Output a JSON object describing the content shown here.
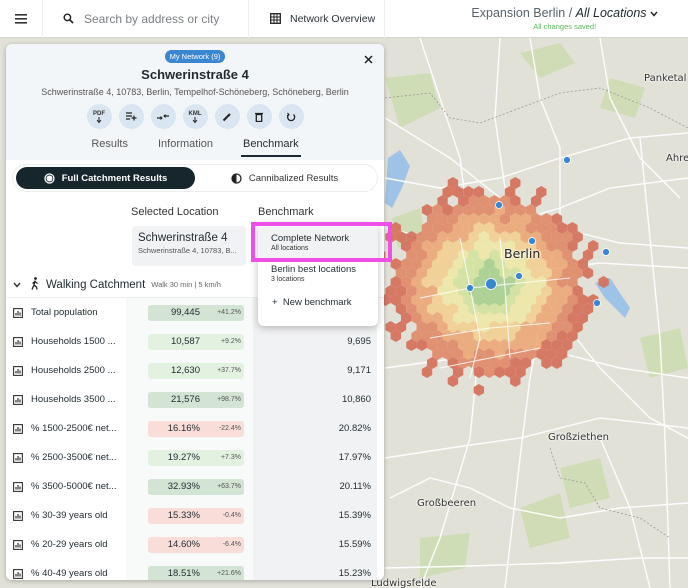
{
  "topbar": {
    "search_placeholder": "Search by address or city",
    "network_overview_label": "Network Overview",
    "project_name": "Expansion Berlin",
    "project_separator": " / ",
    "project_scope": "All Locations",
    "save_status": "All changes saved!"
  },
  "panel": {
    "badge": "My Network (9)",
    "title": "Schwerinstraße 4",
    "address": "Schwerinstraße 4, 10783, Berlin, Tempelhof-Schöneberg, Schöneberg, Berlin",
    "actions": [
      {
        "name": "pdf-download",
        "label": "PDF"
      },
      {
        "name": "add-to-list",
        "label": ""
      },
      {
        "name": "compare",
        "label": ""
      },
      {
        "name": "kml-download",
        "label": "KML"
      },
      {
        "name": "edit",
        "label": ""
      },
      {
        "name": "delete",
        "label": ""
      },
      {
        "name": "refresh",
        "label": ""
      }
    ],
    "tabs": [
      "Results",
      "Information",
      "Benchmark"
    ],
    "active_tab": "Benchmark",
    "toggle": {
      "full_label": "Full Catchment Results",
      "cannibalized_label": "Cannibalized Results",
      "active": "full"
    },
    "columns": {
      "selected": "Selected Location",
      "benchmark": "Benchmark"
    },
    "selected_card": {
      "name": "Schwerinstraße 4",
      "address": "Schwerinstraße 4, 10783, B..."
    },
    "section": {
      "title": "Walking Catchment",
      "subtitle": "Walk 30 min | 5 km/h"
    },
    "rows": [
      {
        "label": "Total population",
        "value": "99,445",
        "delta": "+41.2%",
        "tone": "green-strong",
        "benchmark": ""
      },
      {
        "label": "Households 1500 ...",
        "value": "10,587",
        "delta": "+9.2%",
        "tone": "green-light",
        "benchmark": "9,695"
      },
      {
        "label": "Households 2500 ...",
        "value": "12,630",
        "delta": "+37.7%",
        "tone": "green-light",
        "benchmark": "9,171"
      },
      {
        "label": "Households 3500 ...",
        "value": "21,576",
        "delta": "+98.7%",
        "tone": "green-strong",
        "benchmark": "10,860"
      },
      {
        "label": "% 1500-2500€ net...",
        "value": "16.16%",
        "delta": "-22.4%",
        "tone": "red",
        "benchmark": "20.82%"
      },
      {
        "label": "% 2500-3500€ net...",
        "value": "19.27%",
        "delta": "+7.3%",
        "tone": "green-light",
        "benchmark": "17.97%"
      },
      {
        "label": "% 3500-5000€ net...",
        "value": "32.93%",
        "delta": "+63.7%",
        "tone": "green-strong",
        "benchmark": "20.11%"
      },
      {
        "label": "% 30-39 years old",
        "value": "15.33%",
        "delta": "-0.4%",
        "tone": "red",
        "benchmark": "15.39%"
      },
      {
        "label": "% 20-29 years old",
        "value": "14.60%",
        "delta": "-6.4%",
        "tone": "red",
        "benchmark": "15.59%"
      },
      {
        "label": "% 40-49 years old",
        "value": "18.51%",
        "delta": "+21.6%",
        "tone": "green-strong",
        "benchmark": "15.23%"
      }
    ]
  },
  "dropdown": {
    "items": [
      {
        "title": "Complete Network",
        "subtitle": "All locations",
        "selected": true
      },
      {
        "title": "Berlin best locations",
        "subtitle": "3 locations",
        "selected": false
      }
    ],
    "new_label": "New benchmark"
  },
  "map": {
    "labels": [
      "Panketal",
      "Ahre",
      "Berlin",
      "Großziethen",
      "Großbeeren",
      "Ludwigsfelde"
    ]
  },
  "colors": {
    "accent_blue": "#3b86d1",
    "dark": "#17262c",
    "highlight": "#ee4fe6",
    "saved_green": "#5cb85c",
    "green_strong": "#d3e3d4",
    "green_light": "#e2f1e0",
    "red": "#f8ddd8"
  }
}
